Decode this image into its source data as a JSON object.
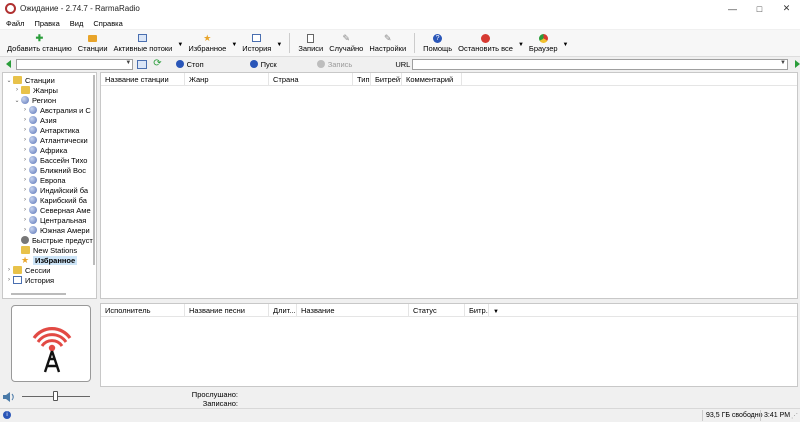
{
  "window": {
    "title": "Ожидание - 2.74.7 - RarmaRadio"
  },
  "menu": [
    "Файл",
    "Правка",
    "Вид",
    "Справка"
  ],
  "toolbar": [
    {
      "label": "Добавить станцию",
      "icon": "add-station-icon"
    },
    {
      "label": "Станции",
      "icon": "stations-icon"
    },
    {
      "label": "Активные потоки",
      "icon": "active-streams-icon",
      "dropdown": true
    },
    {
      "label": "Избранное",
      "icon": "favorites-icon",
      "dropdown": true
    },
    {
      "label": "История",
      "icon": "history-icon",
      "dropdown": true
    },
    {
      "label": "Записи",
      "icon": "recordings-icon"
    },
    {
      "label": "Случайно",
      "icon": "random-icon"
    },
    {
      "label": "Настройки",
      "icon": "settings-icon"
    },
    {
      "label": "Помощь",
      "icon": "help-icon"
    },
    {
      "label": "Остановить все",
      "icon": "stop-all-icon",
      "dropdown": true
    },
    {
      "label": "Браузер",
      "icon": "browser-icon",
      "dropdown": true
    }
  ],
  "address": {
    "stop": "Стоп",
    "play": "Пуск",
    "record": "Запись",
    "url_label": "URL"
  },
  "tree": {
    "stations": "Станции",
    "genres": "Жанры",
    "region": "Регион",
    "regions": [
      "Австралия и С",
      "Азия",
      "Антарктика",
      "Атлантически",
      "Африка",
      "Бассейн Тихо",
      "Ближний Вос",
      "Европа",
      "Индийский ба",
      "Карибский ба",
      "Северная Аме",
      "Центральная",
      "Южная Амери"
    ],
    "quick": "Быстрые предуст",
    "new": "New Stations",
    "favorites": "Избранное",
    "sessions": "Сессии",
    "history": "История"
  },
  "stations_columns": [
    "Название станции",
    "Жанр",
    "Страна",
    "Тип",
    "Битрейт",
    "Комментарий"
  ],
  "songs_columns": [
    "Исполнитель",
    "Название песни",
    "Длит...",
    "Название",
    "Статус",
    "Битр..."
  ],
  "info": {
    "listened": "Прослушано:",
    "recorded": "Записано:"
  },
  "status": {
    "disk": "93,5 ГБ свободно",
    "time": "3:41 PM"
  },
  "colors": {
    "accent_red": "#d63a32",
    "selection": "#cce4f7",
    "folder": "#e8c24a"
  }
}
